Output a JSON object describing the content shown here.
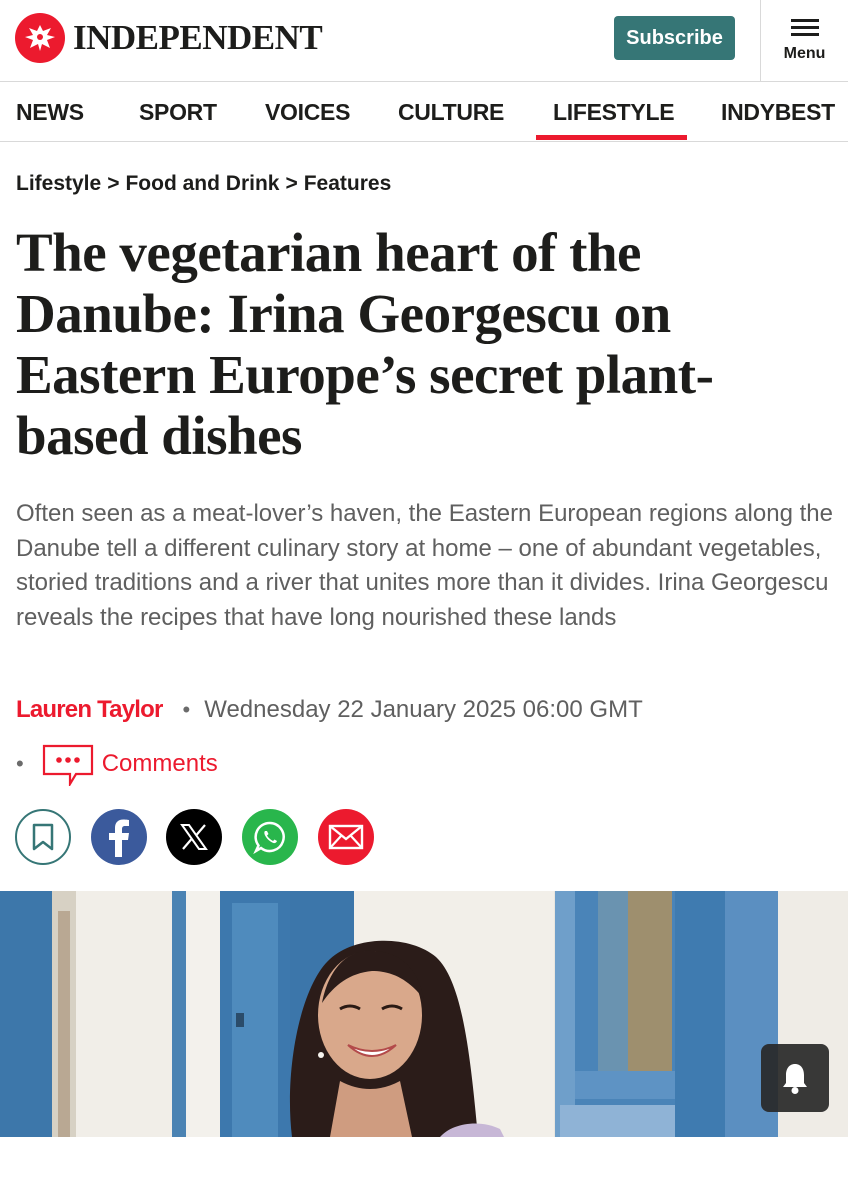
{
  "header": {
    "logo_text": "INDEPENDENT",
    "subscribe_label": "Subscribe",
    "menu_label": "Menu"
  },
  "nav": {
    "items": [
      {
        "label": "NEWS"
      },
      {
        "label": "SPORT"
      },
      {
        "label": "VOICES"
      },
      {
        "label": "CULTURE"
      },
      {
        "label": "LIFESTYLE",
        "active": true
      },
      {
        "label": "INDYBEST"
      }
    ]
  },
  "breadcrumb": {
    "items": [
      "Lifestyle",
      "Food and Drink",
      "Features"
    ],
    "separator": ">"
  },
  "article": {
    "headline": "The vegetarian heart of the Danube: Irina Georgescu on Eastern Europe’s secret plant-based dishes",
    "standfirst": "Often seen as a meat-lover’s haven, the Eastern European regions along the Danube tell a different culinary story at home – one of abundant vegetables, storied traditions and a river that unites more than it divides. Irina Georgescu reveals the recipes that have long nourished these lands",
    "author": "Lauren Taylor",
    "bullet": "•",
    "date": "Wednesday 22 January 2025 06:00 GMT",
    "comments_label": "Comments"
  },
  "share": {
    "icons": [
      "bookmark-icon",
      "facebook-icon",
      "x-icon",
      "whatsapp-icon",
      "email-icon"
    ]
  },
  "colors": {
    "brand_red": "#ec1a2e",
    "subscribe_teal": "#367676",
    "facebook_blue": "#3b5a9c",
    "whatsapp_green": "#29b64c",
    "text_dark": "#1d1d1b",
    "text_grey": "#5f5f5f"
  }
}
